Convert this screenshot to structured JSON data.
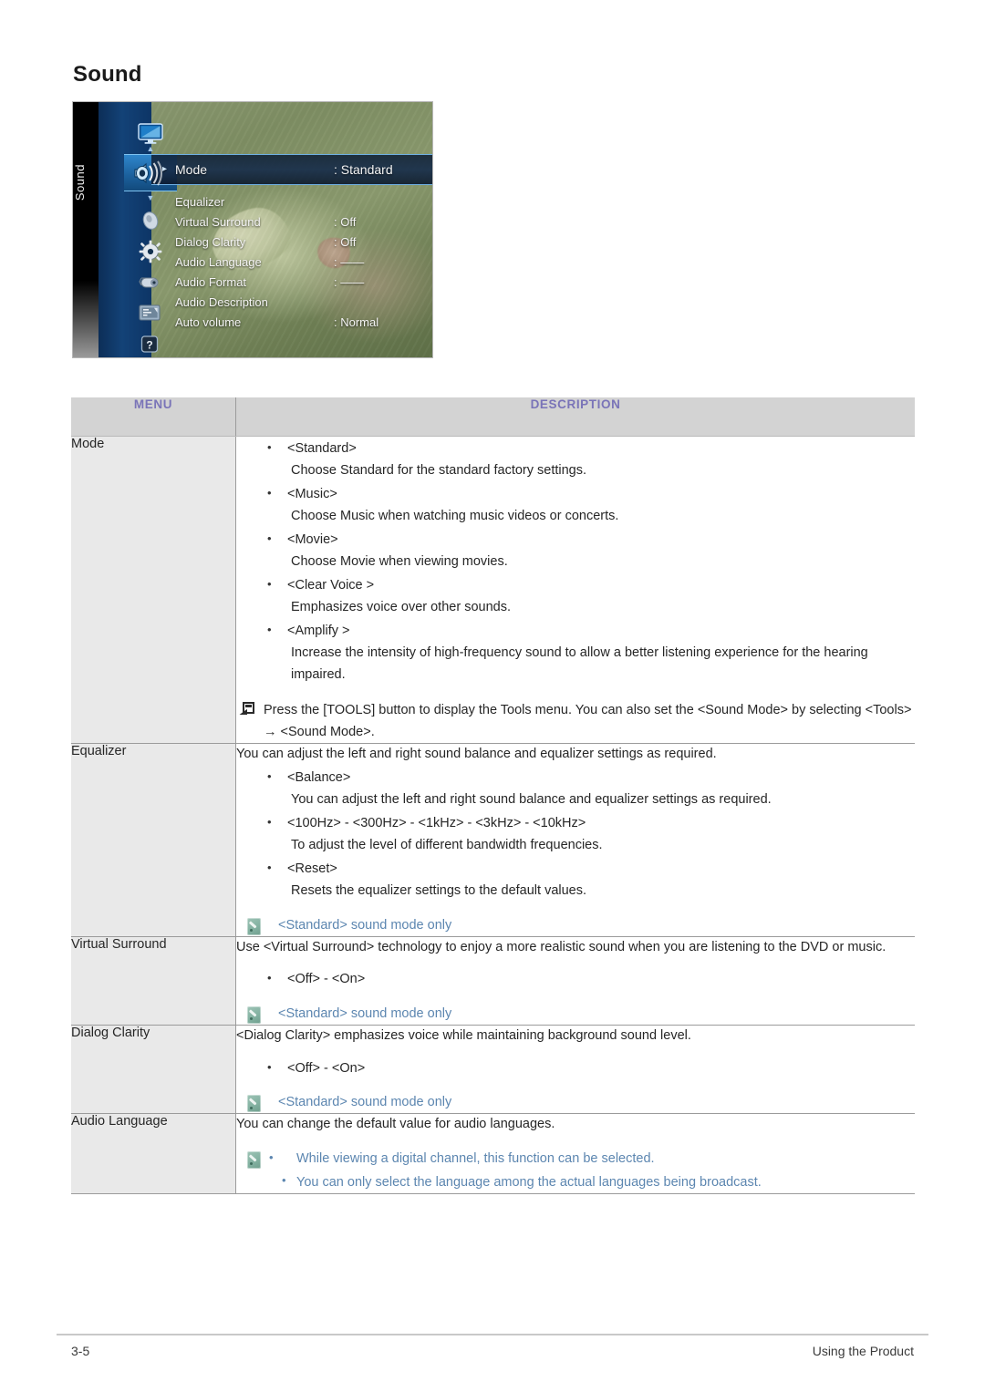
{
  "page": {
    "title": "Sound",
    "footer_left": "3-5",
    "footer_right": "Using the Product"
  },
  "osd": {
    "strip_label": "Sound",
    "rows": [
      {
        "label": "Mode",
        "value": ": Standard",
        "highlighted": true,
        "caret": "▸"
      },
      {
        "label": "Equalizer",
        "value": ""
      },
      {
        "label": "Virtual Surround",
        "value": ": Off"
      },
      {
        "label": "Dialog Clarity",
        "value": ": Off"
      },
      {
        "label": "Audio Language",
        "value": ": ——"
      },
      {
        "label": "Audio Format",
        "value": ": ——"
      },
      {
        "label": "Audio Description",
        "value": ""
      },
      {
        "label": "Auto volume",
        "value": ": Normal"
      }
    ],
    "rail_icons": [
      "picture-icon",
      "sound-icon",
      "channel-icon",
      "setup-icon",
      "input-icon",
      "application-icon",
      "support-icon"
    ],
    "rail_up_arrow": "▲",
    "rail_down_arrow": "▼"
  },
  "table": {
    "headers": {
      "menu": "MENU",
      "description": "DESCRIPTION"
    },
    "header_color": "#7a74b8",
    "note_color": "#5c86b0",
    "rows": [
      {
        "menu": "Mode",
        "bullets": [
          {
            "head": "<Standard>",
            "body": "Choose Standard for the standard factory settings."
          },
          {
            "head": "<Music>",
            "body": "Choose Music when watching music videos or concerts."
          },
          {
            "head": "<Movie>",
            "body": "Choose Movie when viewing movies."
          },
          {
            "head": "<Clear Voice >",
            "body": "Emphasizes voice over other sounds."
          },
          {
            "head": "<Amplify >",
            "body": "Increase the intensity of high-frequency sound to allow a better listening experience for the hearing impaired."
          }
        ],
        "tools_note": "Press the [TOOLS] button to display the Tools menu. You can also set the <Sound Mode> by selecting <Tools> → <Sound Mode>."
      },
      {
        "menu": "Equalizer",
        "intro": "You can adjust the left and right sound balance and equalizer settings as required.",
        "bullets": [
          {
            "head": "<Balance>",
            "body": "You can adjust the left and right sound balance and equalizer settings as required."
          },
          {
            "head": "<100Hz> - <300Hz> - <1kHz> - <3kHz> - <10kHz>",
            "body": "To adjust the level of different bandwidth frequencies."
          },
          {
            "head": "<Reset>",
            "body": "Resets the equalizer settings to the default values."
          }
        ],
        "note": "<Standard> sound mode only"
      },
      {
        "menu": "Virtual Surround",
        "intro": "Use <Virtual Surround> technology to enjoy a more realistic sound when you are listening to the DVD or music.",
        "bullets": [
          {
            "head": "<Off> - <On>",
            "body": ""
          }
        ],
        "note": "<Standard> sound mode only"
      },
      {
        "menu": "Dialog Clarity",
        "intro": "<Dialog Clarity> emphasizes voice while maintaining background sound level.",
        "bullets": [
          {
            "head": "<Off> - <On>",
            "body": ""
          }
        ],
        "note": "<Standard> sound mode only"
      },
      {
        "menu": "Audio Language",
        "intro": "You can change the default value for audio languages.",
        "note_bullets": [
          "While viewing a digital channel, this function can be selected.",
          "You can only select the language among the actual languages being broadcast."
        ]
      }
    ]
  }
}
